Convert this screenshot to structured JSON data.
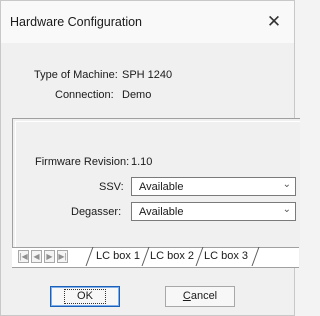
{
  "window": {
    "title": "Hardware Configuration",
    "close_glyph": "✕"
  },
  "info": {
    "machine_type_label": "Type of Machine:",
    "machine_type_value": "SPH 1240",
    "connection_label": "Connection:",
    "connection_value": "Demo"
  },
  "panel": {
    "firmware_label": "Firmware Revision:",
    "firmware_value": "1.10",
    "ssv_label": "SSV:",
    "ssv_value": "Available",
    "degasser_label": "Degasser:",
    "degasser_value": "Available"
  },
  "tabs": {
    "nav_icons": [
      "first-icon",
      "prev-icon",
      "next-icon",
      "last-icon"
    ],
    "items": [
      {
        "label": "LC box 1",
        "active": true
      },
      {
        "label": "LC box 2",
        "active": false
      },
      {
        "label": "LC box 3",
        "active": false
      }
    ]
  },
  "buttons": {
    "ok_label": "OK",
    "cancel_underline": "C",
    "cancel_rest": "ancel"
  },
  "colors": {
    "default_button_border": "#1a60b8",
    "window_bg": "#f0f0f0"
  }
}
